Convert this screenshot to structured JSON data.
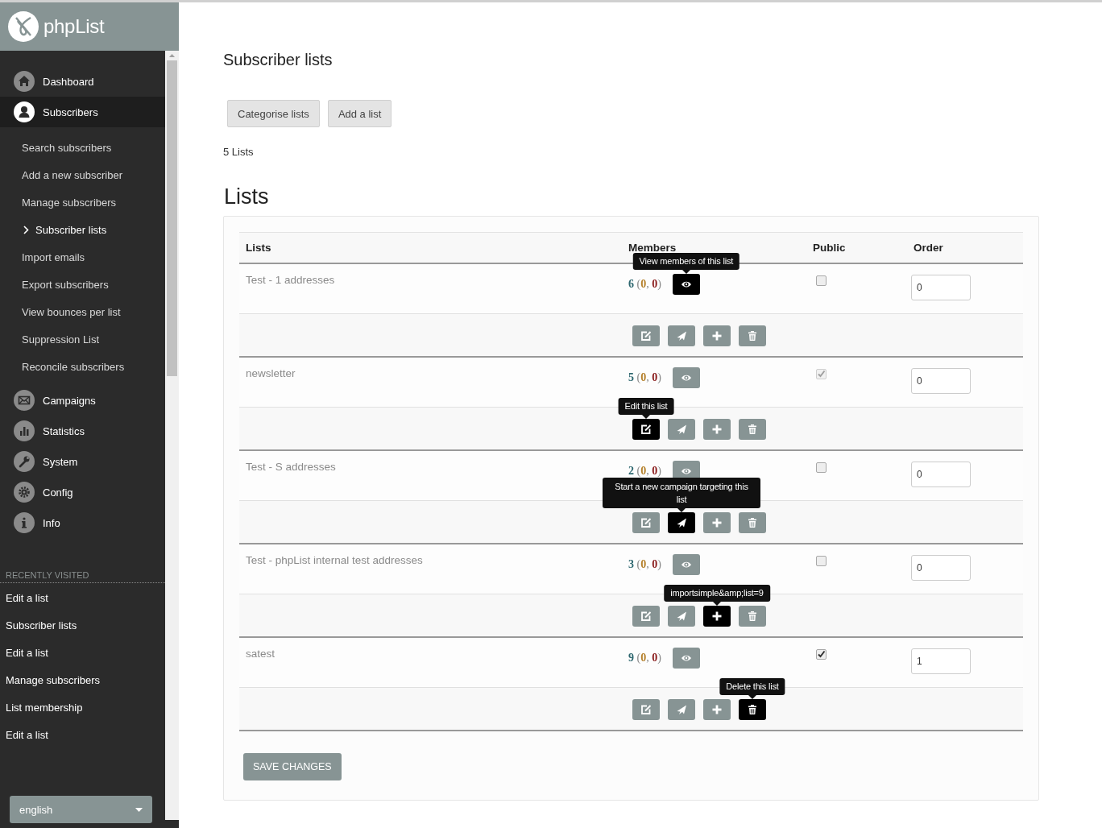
{
  "logo": {
    "text": "phpList"
  },
  "nav": [
    {
      "label": "Dashboard",
      "selected": false
    },
    {
      "label": "Subscribers",
      "selected": true,
      "children": [
        {
          "label": "Search subscribers",
          "selected": false
        },
        {
          "label": "Add a new subscriber",
          "selected": false
        },
        {
          "label": "Manage subscribers",
          "selected": false
        },
        {
          "label": "Subscriber lists",
          "selected": true
        },
        {
          "label": "Import emails",
          "selected": false
        },
        {
          "label": "Export subscribers",
          "selected": false
        },
        {
          "label": "View bounces per list",
          "selected": false
        },
        {
          "label": "Suppression List",
          "selected": false
        },
        {
          "label": "Reconcile subscribers",
          "selected": false
        }
      ]
    },
    {
      "label": "Campaigns",
      "selected": false
    },
    {
      "label": "Statistics",
      "selected": false
    },
    {
      "label": "System",
      "selected": false
    },
    {
      "label": "Config",
      "selected": false
    },
    {
      "label": "Info",
      "selected": false
    }
  ],
  "recently_visited": {
    "title": "RECENTLY VISITED",
    "items": [
      "Edit a list",
      "Subscriber lists",
      "Edit a list",
      "Manage subscribers",
      "List membership",
      "Edit a list"
    ]
  },
  "language_select": {
    "value": "english"
  },
  "page": {
    "title": "Subscriber lists",
    "buttons": [
      "Categorise lists",
      "Add a list"
    ],
    "count": "5 Lists",
    "section_title": "Lists"
  },
  "table": {
    "columns": [
      "Lists",
      "Members",
      "Public",
      "Order"
    ],
    "rows": [
      {
        "name": "Test - 1 addresses",
        "members": "6 (0, 0)",
        "public": {
          "checked": false,
          "disabled": false
        },
        "order": "0",
        "buttons": [
          {
            "hovered": true,
            "tooltip": "View members of this list"
          },
          {
            "hovered": false
          },
          {
            "hovered": false
          },
          {
            "hovered": false
          },
          {
            "hovered": false
          }
        ]
      },
      {
        "name": "newsletter",
        "members": "5 (0, 0)",
        "public": {
          "checked": true,
          "disabled": true
        },
        "order": "0",
        "buttons": [
          {
            "hovered": false
          },
          {
            "hovered": true,
            "tooltip": "Edit this list"
          },
          {
            "hovered": false
          },
          {
            "hovered": false
          },
          {
            "hovered": false
          }
        ]
      },
      {
        "name": "Test - S addresses",
        "members": "2 (0, 0)",
        "public": {
          "checked": false,
          "disabled": false
        },
        "order": "0",
        "buttons": [
          {
            "hovered": false
          },
          {
            "hovered": false
          },
          {
            "hovered": true,
            "tooltip": "Start a new campaign targeting this list"
          },
          {
            "hovered": false
          },
          {
            "hovered": false
          }
        ]
      },
      {
        "name": "Test - phpList internal test addresses",
        "members": "3 (0, 0)",
        "public": {
          "checked": false,
          "disabled": false
        },
        "order": "0",
        "buttons": [
          {
            "hovered": false
          },
          {
            "hovered": false
          },
          {
            "hovered": false
          },
          {
            "hovered": true,
            "tooltip": "importsimple&amp;list=9"
          },
          {
            "hovered": false
          }
        ]
      },
      {
        "name": "satest",
        "members": "9 (0, 0)",
        "public": {
          "checked": true,
          "disabled": false
        },
        "order": "1",
        "buttons": [
          {
            "hovered": false
          },
          {
            "hovered": false
          },
          {
            "hovered": false
          },
          {
            "hovered": false
          },
          {
            "hovered": true,
            "tooltip": "Delete this list"
          }
        ]
      }
    ]
  },
  "save_button": "SAVE CHANGES"
}
